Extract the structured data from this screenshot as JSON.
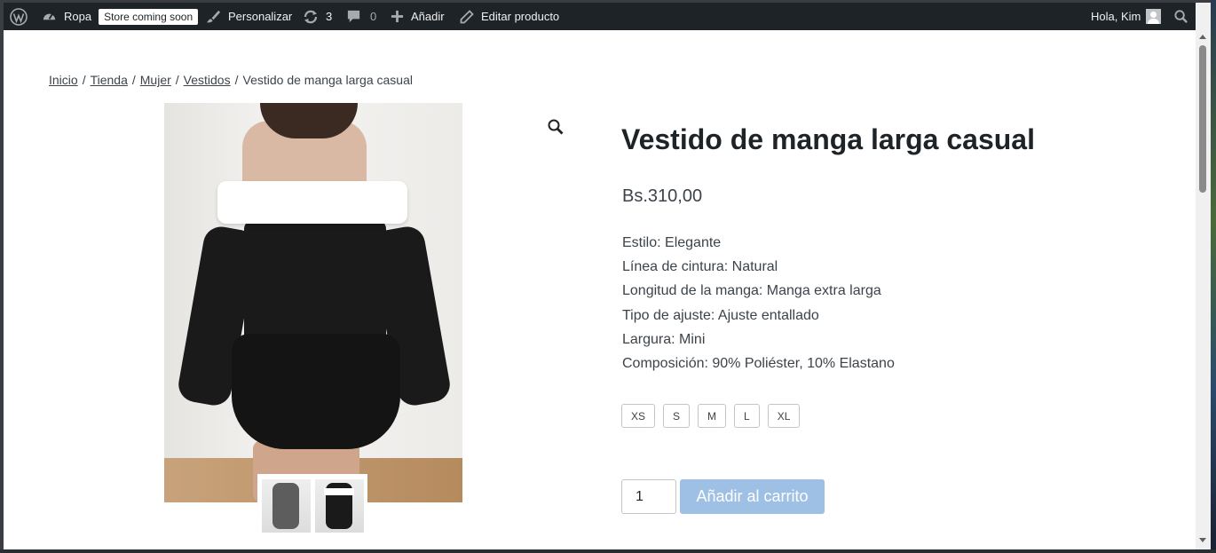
{
  "adminbar": {
    "site_name": "Ropa",
    "store_badge": "Store coming soon",
    "customize": "Personalizar",
    "updates_count": "3",
    "comments_count": "0",
    "add_new": "Añadir",
    "edit_product": "Editar producto",
    "greeting": "Hola, Kim"
  },
  "breadcrumb": {
    "items": [
      "Inicio",
      "Tienda",
      "Mujer",
      "Vestidos"
    ],
    "separator": "/",
    "current": "Vestido de manga larga casual"
  },
  "product": {
    "title": "Vestido de manga larga casual",
    "price": "Bs.310,00",
    "attributes": [
      "Estilo: Elegante",
      "Línea de cintura: Natural",
      "Longitud de la manga: Manga extra larga",
      "Tipo de ajuste: Ajuste entallado",
      "Largura: Mini",
      "Composición: 90% Poliéster, 10% Elastano"
    ],
    "sizes": [
      "XS",
      "S",
      "M",
      "L",
      "XL"
    ],
    "quantity": "1",
    "add_to_cart": "Añadir al carrito"
  },
  "colors": {
    "adminbar_bg": "#1d2327",
    "button_bg": "#9ec0e5",
    "text": "#3c434a"
  }
}
